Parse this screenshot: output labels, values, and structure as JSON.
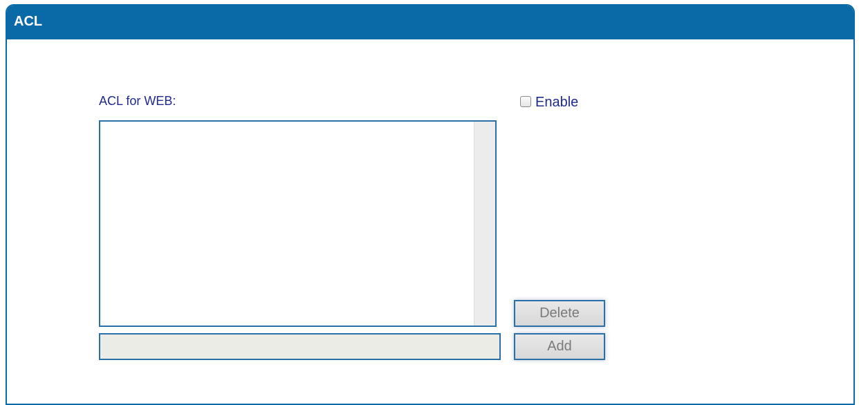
{
  "panel": {
    "title": "ACL"
  },
  "acl": {
    "label": "ACL for WEB:",
    "enable_label": "Enable",
    "enable_checked": false,
    "entries": [],
    "new_entry_value": ""
  },
  "buttons": {
    "delete_label": "Delete",
    "add_label": "Add"
  }
}
